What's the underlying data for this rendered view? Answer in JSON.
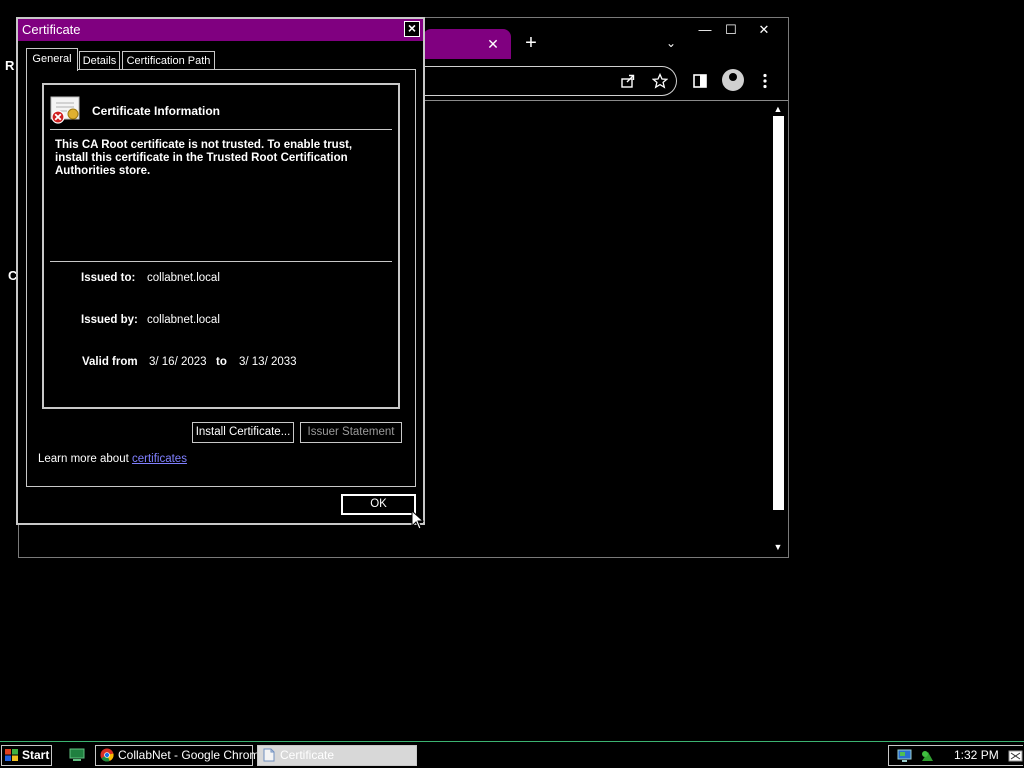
{
  "dialog": {
    "title": "Certificate",
    "tabs": [
      "General",
      "Details",
      "Certification Path"
    ],
    "info_title": "Certificate Information",
    "warning": "This CA Root certificate is not trusted. To enable trust, install this certificate in the Trusted Root Certification Authorities store.",
    "issued_to_label": "Issued to:",
    "issued_to": "collabnet.local",
    "issued_by_label": "Issued by:",
    "issued_by": "collabnet.local",
    "valid_from_label": "Valid from",
    "valid_from": "3/ 16/ 2023",
    "valid_to_label": "to",
    "valid_to": "3/ 13/ 2033",
    "install_button": "Install Certificate...",
    "issuer_button": "Issuer Statement",
    "learn_prefix": "Learn more about ",
    "learn_link": "certificates",
    "ok_button": "OK"
  },
  "chrome": {
    "tab_close": "✕",
    "new_tab": "+",
    "tab_search": "⌄",
    "minimize": "—",
    "maximize": "☐",
    "close": "✕",
    "page_fragments": [
      "R",
      "C"
    ]
  },
  "taskbar": {
    "start": "Start",
    "chrome_task": "CollabNet - Google Chrome",
    "cert_task": "Certificate",
    "clock": "1:32 PM"
  },
  "colors": {
    "title_bar": "#800080",
    "link": "#8080ff",
    "taskbar_accent": "#3cb371"
  }
}
